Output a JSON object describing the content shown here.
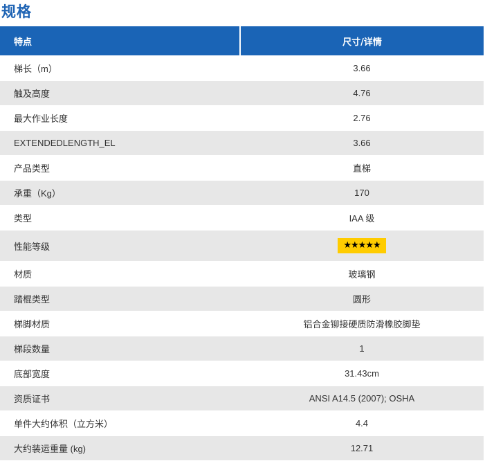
{
  "page": {
    "title": "规格"
  },
  "table": {
    "headers": {
      "feature": "特点",
      "detail": "尺寸/详情"
    },
    "rows": [
      {
        "feature": "梯长（m）",
        "detail": "3.66"
      },
      {
        "feature": "触及高度",
        "detail": "4.76"
      },
      {
        "feature": "最大作业长度",
        "detail": "2.76"
      },
      {
        "feature": "EXTENDEDLENGTH_EL",
        "detail": "3.66"
      },
      {
        "feature": "产品类型",
        "detail": "直梯"
      },
      {
        "feature": "承重（Kg）",
        "detail": "170"
      },
      {
        "feature": "类型",
        "detail": "IAA 级"
      },
      {
        "feature": "性能等级",
        "detail": "★★★★★",
        "rating_stars": 5
      },
      {
        "feature": "材质",
        "detail": "玻璃钢"
      },
      {
        "feature": "踏棍类型",
        "detail": "圆形"
      },
      {
        "feature": "梯脚材质",
        "detail": "铝合金铆接硬质防滑橡胶脚垫"
      },
      {
        "feature": "梯段数量",
        "detail": "1"
      },
      {
        "feature": "底部宽度",
        "detail": "31.43cm"
      },
      {
        "feature": "资质证书",
        "detail": "ANSI A14.5 (2007); OSHA"
      },
      {
        "feature": "单件大约体积（立方米）",
        "detail": "4.4"
      },
      {
        "feature": "大约装运重量 (kg)",
        "detail": "12.71"
      }
    ]
  },
  "colors": {
    "title": "#1f64b4",
    "header_bg": "#1a64b6",
    "row_alt_bg": "#e7e7e7",
    "rating_bg": "#ffcc00"
  },
  "icons": {
    "rating": "star-icon"
  }
}
